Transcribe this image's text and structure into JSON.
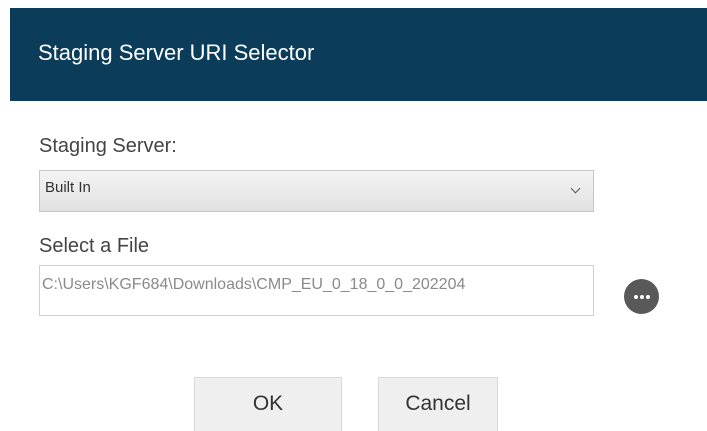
{
  "dialog": {
    "title": "Staging Server URI Selector"
  },
  "staging_server": {
    "label": "Staging Server:",
    "selected": "Built In",
    "dropdown_icon": "chevron-down-icon"
  },
  "file": {
    "label": "Select a File",
    "value": "C:\\Users\\KGF684\\Downloads\\CMP_EU_0_18_0_0_202204",
    "browse_icon": "more-horizontal-icon"
  },
  "buttons": {
    "ok": "OK",
    "cancel": "Cancel"
  },
  "colors": {
    "header_bg": "#0b3d5a",
    "header_text": "#ffffff",
    "browse_button": "#595959"
  }
}
